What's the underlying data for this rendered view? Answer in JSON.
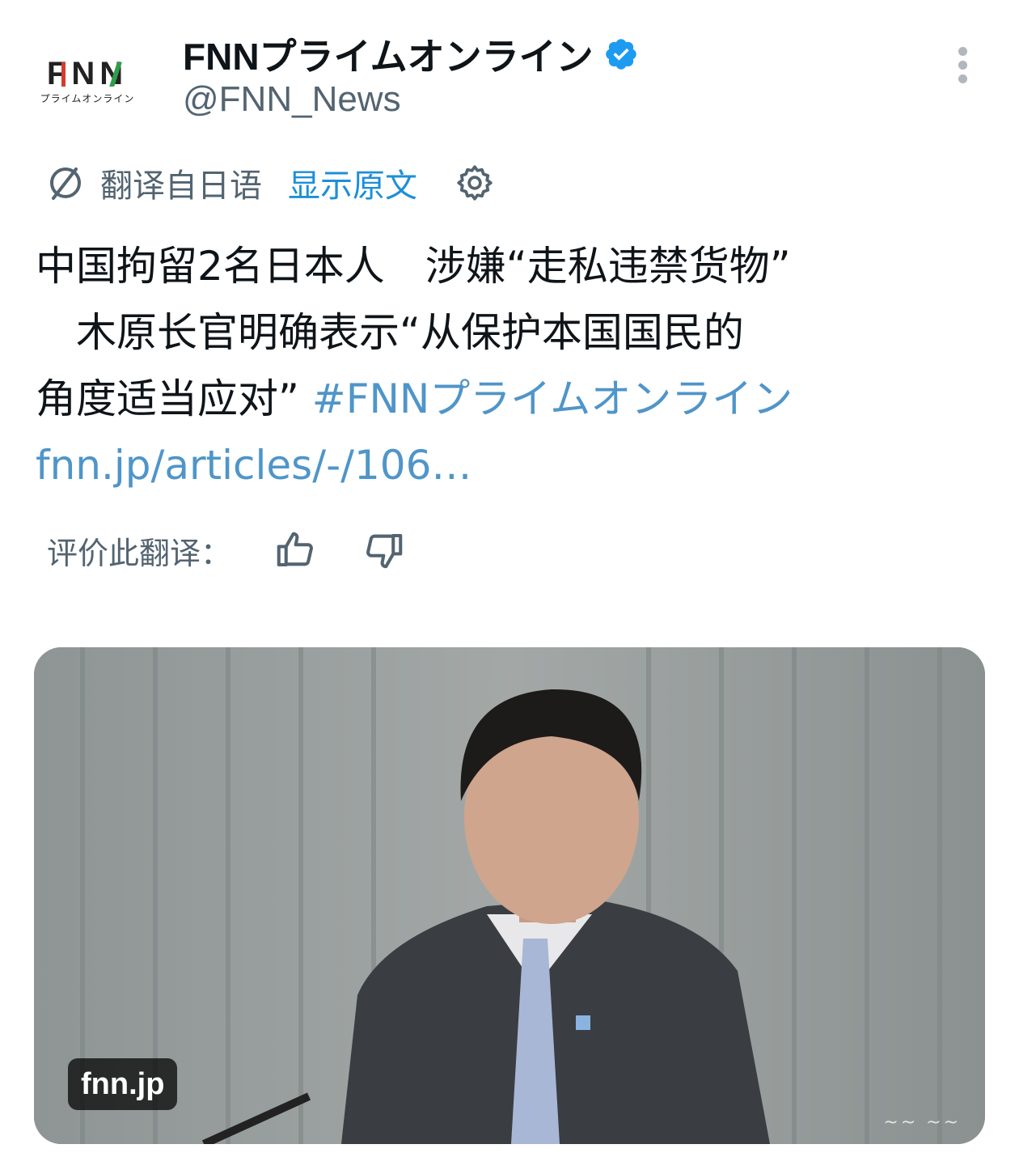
{
  "account": {
    "avatar_logo": "FNN",
    "avatar_sub": "プライムオンライン",
    "display_name": "FNNプライムオンライン",
    "handle": "@FNN_News",
    "verified": true,
    "more_icon": "more-vertical-icon"
  },
  "translation": {
    "icon": "translate-globe-icon",
    "translated_from": "翻译自日语",
    "show_original": "显示原文",
    "settings_icon": "gear-icon"
  },
  "tweet": {
    "text_line1": "中国拘留2名日本人　涉嫌“走私违禁货物”",
    "text_line2": "　木原长官明确表示“从保护本国国民的",
    "text_line3": "角度适当应对” ",
    "hashtag": "#FNNプライムオンライン",
    "url": "fnn.jp/articles/-/106…"
  },
  "rating": {
    "label": "评价此翻译：",
    "thumb_up_icon": "thumb-up-icon",
    "thumb_down_icon": "thumb-down-icon"
  },
  "media": {
    "domain": "fnn.jp",
    "watermark": "~~ ~~"
  },
  "colors": {
    "link": "#4f95c9",
    "accent": "#1d8fd8",
    "secondary_text": "#536471",
    "verified_badge": "#1d9bf0"
  }
}
